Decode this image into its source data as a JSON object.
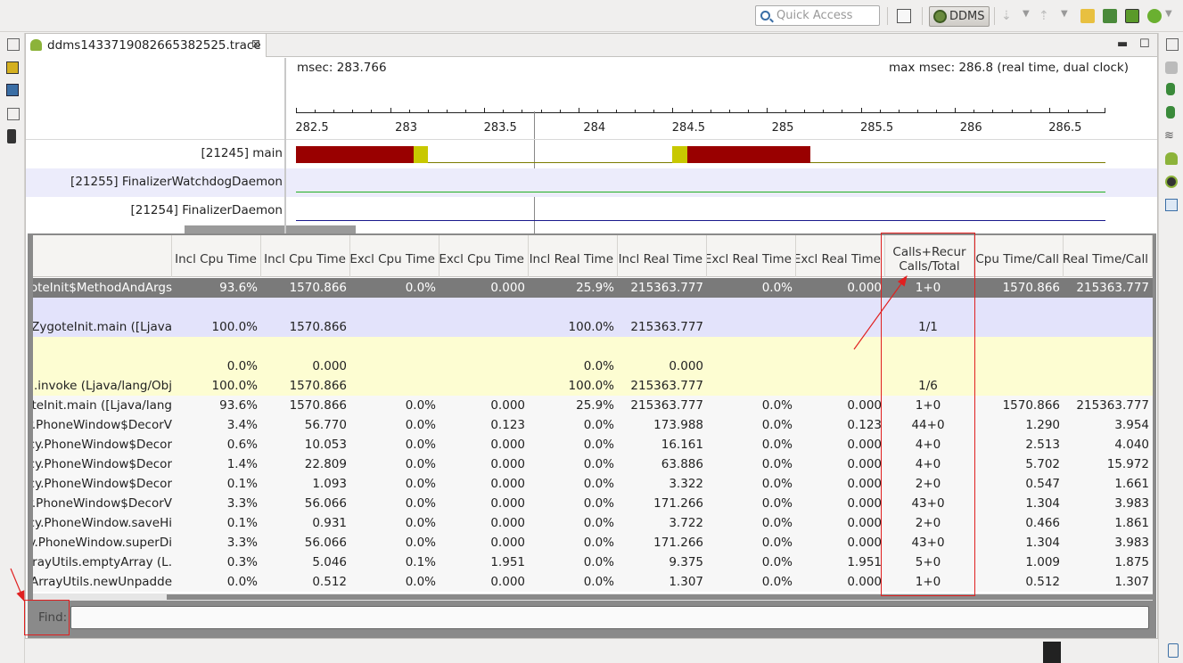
{
  "toolbar": {
    "quick_access_placeholder": "Quick Access",
    "perspective_label": "DDMS"
  },
  "editor_tab": {
    "title": "ddms1433719082665382525.trace",
    "close_glyph": "⊠"
  },
  "window_buttons": {
    "minimize": "▬",
    "maximize": "☐"
  },
  "timeline": {
    "msec_label": "msec: 283.766",
    "max_label": "max msec: 286.8 (real time, dual clock)",
    "ticks": [
      "282.5",
      "283",
      "283.5",
      "284",
      "284.5",
      "285",
      "285.5",
      "286",
      "286.5"
    ],
    "threads": [
      {
        "name": "[21245] main",
        "line_color": "#7b7b00"
      },
      {
        "name": "[21255] FinalizerWatchdogDaemon",
        "line_color": "#22b022"
      },
      {
        "name": "[21254] FinalizerDaemon",
        "line_color": "#1a1a8c"
      }
    ],
    "segment_colors": {
      "dark_red": "#990000",
      "yellow": "#c8c800"
    }
  },
  "table": {
    "headers": {
      "incl_cpu_pct": "Incl Cpu Time",
      "incl_cpu": "Incl Cpu Time",
      "excl_cpu_pct": "Excl Cpu Time",
      "excl_cpu": "Excl Cpu Time",
      "incl_real_pct": "Incl Real Time",
      "incl_real": "Incl Real Time",
      "excl_real_pct": "Excl Real Time",
      "excl_real": "Excl Real Time",
      "calls": "Calls+Recur\nCalls/Total",
      "cpu_per_call": "Cpu Time/Call",
      "real_per_call": "Real Time/Call"
    },
    "rows": [
      {
        "style": "selected",
        "name": "oteInit$MethodAndArgs",
        "c1": "93.6%",
        "c2": "1570.866",
        "c3": "0.0%",
        "c4": "0.000",
        "c5": "25.9%",
        "c6": "215363.777",
        "c7": "0.0%",
        "c8": "0.000",
        "c9": "1+0",
        "c10": "1570.866",
        "c11": "215363.777"
      },
      {
        "style": "parent",
        "name": "",
        "c1": "",
        "c2": "",
        "c3": "",
        "c4": "",
        "c5": "",
        "c6": "",
        "c7": "",
        "c8": "",
        "c9": "",
        "c10": "",
        "c11": ""
      },
      {
        "style": "parent",
        "name": "s.ZygoteInit.main ([Ljava/",
        "c1": "100.0%",
        "c2": "1570.866",
        "c3": "",
        "c4": "",
        "c5": "100.0%",
        "c6": "215363.777",
        "c7": "",
        "c8": "",
        "c9": "1/1",
        "c10": "",
        "c11": ""
      },
      {
        "style": "child",
        "name": "",
        "c1": "",
        "c2": "",
        "c3": "",
        "c4": "",
        "c5": "",
        "c6": "",
        "c7": "",
        "c8": "",
        "c9": "",
        "c10": "",
        "c11": ""
      },
      {
        "style": "child",
        "name": "",
        "c1": "0.0%",
        "c2": "0.000",
        "c3": "",
        "c4": "",
        "c5": "0.0%",
        "c6": "0.000",
        "c7": "",
        "c8": "",
        "c9": "",
        "c10": "",
        "c11": ""
      },
      {
        "style": "child",
        "name": "od.invoke (Ljava/lang/Obj",
        "c1": "100.0%",
        "c2": "1570.866",
        "c3": "",
        "c4": "",
        "c5": "100.0%",
        "c6": "215363.777",
        "c7": "",
        "c8": "",
        "c9": "1/6",
        "c10": "",
        "c11": ""
      },
      {
        "style": "plain",
        "name": "oteInit.main ([Ljava/lang",
        "c1": "93.6%",
        "c2": "1570.866",
        "c3": "0.0%",
        "c4": "0.000",
        "c5": "25.9%",
        "c6": "215363.777",
        "c7": "0.0%",
        "c8": "0.000",
        "c9": "1+0",
        "c10": "1570.866",
        "c11": "215363.777"
      },
      {
        "style": "plain",
        "name": "y.PhoneWindow$DecorV",
        "c1": "3.4%",
        "c2": "56.770",
        "c3": "0.0%",
        "c4": "0.123",
        "c5": "0.0%",
        "c6": "173.988",
        "c7": "0.0%",
        "c8": "0.123",
        "c9": "44+0",
        "c10": "1.290",
        "c11": "3.954"
      },
      {
        "style": "plain",
        "name": "cy.PhoneWindow$Decor",
        "c1": "0.6%",
        "c2": "10.053",
        "c3": "0.0%",
        "c4": "0.000",
        "c5": "0.0%",
        "c6": "16.161",
        "c7": "0.0%",
        "c8": "0.000",
        "c9": "4+0",
        "c10": "2.513",
        "c11": "4.040"
      },
      {
        "style": "plain",
        "name": "cy.PhoneWindow$Decor",
        "c1": "1.4%",
        "c2": "22.809",
        "c3": "0.0%",
        "c4": "0.000",
        "c5": "0.0%",
        "c6": "63.886",
        "c7": "0.0%",
        "c8": "0.000",
        "c9": "4+0",
        "c10": "5.702",
        "c11": "15.972"
      },
      {
        "style": "plain",
        "name": "cy.PhoneWindow$Decor",
        "c1": "0.1%",
        "c2": "1.093",
        "c3": "0.0%",
        "c4": "0.000",
        "c5": "0.0%",
        "c6": "3.322",
        "c7": "0.0%",
        "c8": "0.000",
        "c9": "2+0",
        "c10": "0.547",
        "c11": "1.661"
      },
      {
        "style": "plain",
        "name": "y.PhoneWindow$DecorV",
        "c1": "3.3%",
        "c2": "56.066",
        "c3": "0.0%",
        "c4": "0.000",
        "c5": "0.0%",
        "c6": "171.266",
        "c7": "0.0%",
        "c8": "0.000",
        "c9": "43+0",
        "c10": "1.304",
        "c11": "3.983"
      },
      {
        "style": "plain",
        "name": "cy.PhoneWindow.saveHi",
        "c1": "0.1%",
        "c2": "0.931",
        "c3": "0.0%",
        "c4": "0.000",
        "c5": "0.0%",
        "c6": "3.722",
        "c7": "0.0%",
        "c8": "0.000",
        "c9": "2+0",
        "c10": "0.466",
        "c11": "1.861"
      },
      {
        "style": "plain",
        "name": "y.PhoneWindow.superDi",
        "c1": "3.3%",
        "c2": "56.066",
        "c3": "0.0%",
        "c4": "0.000",
        "c5": "0.0%",
        "c6": "171.266",
        "c7": "0.0%",
        "c8": "0.000",
        "c9": "43+0",
        "c10": "1.304",
        "c11": "3.983"
      },
      {
        "style": "plain",
        "name": ".ArrayUtils.emptyArray (L",
        "c1": "0.3%",
        "c2": "5.046",
        "c3": "0.1%",
        "c4": "1.951",
        "c5": "0.0%",
        "c6": "9.375",
        "c7": "0.0%",
        "c8": "1.951",
        "c9": "5+0",
        "c10": "1.009",
        "c11": "1.875"
      },
      {
        "style": "plain",
        "name": "il.ArrayUtils.newUnpadde",
        "c1": "0.0%",
        "c2": "0.512",
        "c3": "0.0%",
        "c4": "0.000",
        "c5": "0.0%",
        "c6": "1.307",
        "c7": "0.0%",
        "c8": "0.000",
        "c9": "1+0",
        "c10": "0.512",
        "c11": "1.307"
      }
    ]
  },
  "find": {
    "label": "Find:",
    "value": ""
  },
  "colors": {
    "selected_row": "#7a7a7a",
    "parent_row": "#e3e3fb",
    "child_row": "#fdfdd2",
    "plain_row": "#f7f7f7",
    "annotation_red": "#e02020"
  }
}
